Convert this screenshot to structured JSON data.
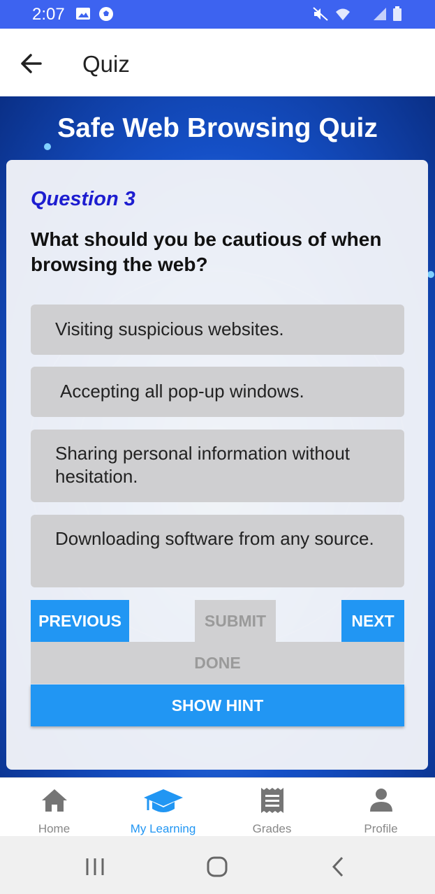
{
  "status": {
    "time": "2:07"
  },
  "app_bar": {
    "title": "Quiz"
  },
  "quiz": {
    "title": "Safe Web Browsing Quiz",
    "question_number": "Question 3",
    "question_text": "What should you be cautious of when browsing the web?",
    "options": [
      "Visiting suspicious websites.",
      " Accepting all pop-up windows.",
      " Sharing personal information without hesitation.",
      " Downloading software from any source."
    ],
    "buttons": {
      "previous": "PREVIOUS",
      "submit": "SUBMIT",
      "next": "NEXT",
      "done": "DONE",
      "hint": "SHOW HINT"
    }
  },
  "bottom_nav": {
    "items": [
      {
        "label": "Home",
        "icon": "home-icon"
      },
      {
        "label": "My Learning",
        "icon": "graduation-cap-icon",
        "active": true
      },
      {
        "label": "Grades",
        "icon": "receipt-icon"
      },
      {
        "label": "Profile",
        "icon": "person-icon"
      }
    ]
  },
  "colors": {
    "status_bar": "#3d63f0",
    "accent": "#2196f3",
    "question_number": "#1d1dd0",
    "disabled": "#d0d0d2"
  }
}
